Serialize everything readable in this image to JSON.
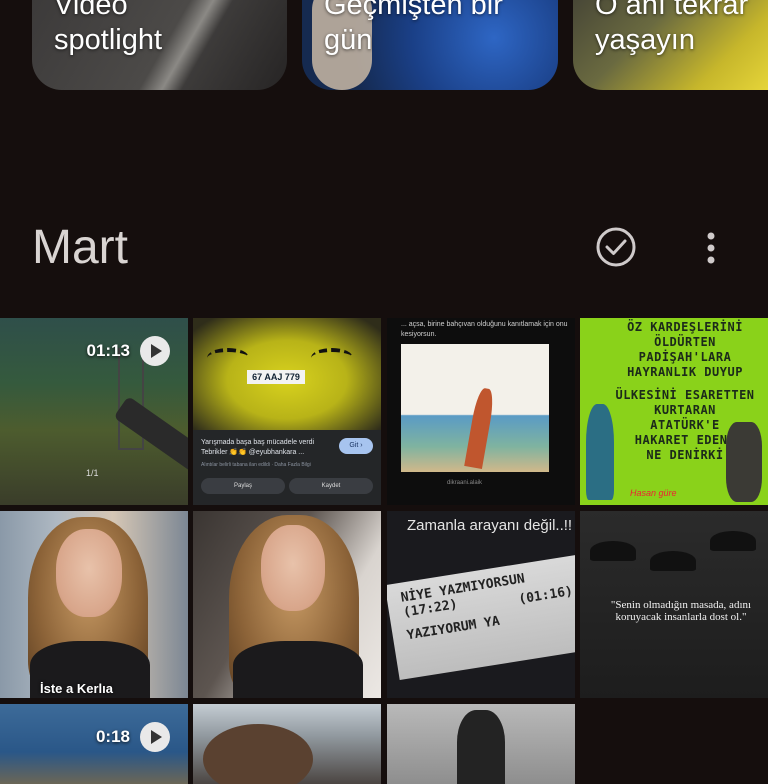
{
  "memories": [
    {
      "label": "Video\nspotlight"
    },
    {
      "label": "Geçmişten bir\ngün"
    },
    {
      "label": "O anı tekrar\nyaşayın"
    }
  ],
  "section": {
    "month": "Mart",
    "select_icon": "check-circle-icon",
    "more_icon": "more-vertical-icon"
  },
  "grid": {
    "video1_duration": "01:13",
    "video2_duration": "0:18",
    "tile1_counter": "1/1",
    "car_plate": "67 AAJ 779",
    "car_post_text": "Yarışmada başa baş mücadele verdi Tebrikler 👏👏 @eyubhankara ...",
    "car_post_sub": "Alıntılar belirli tabana ilan edildi · Daha Fazla Bilgi",
    "car_goto_button": "Git ›",
    "car_share_button": "Paylaş",
    "car_save_button": "Kaydet",
    "painting_text": "... açsa, birine bahçıvan olduğunu kanıtlamak için onu kesiyorsun.",
    "painting_caption": "dikraani.alaik",
    "poster_lines": [
      "ÖZ KARDEŞLERİNİ",
      "ÖLDÜRTEN",
      "PADİŞAH'LARA",
      "HAYRANLIK DUYUP",
      "ÜLKESİNİ ESARETTEN",
      "KURTARAN",
      "ATATÜRK'E",
      "HAKARET EDENE",
      "NE DENİRKİ"
    ],
    "poster_signature": "Hasan güre",
    "girl_tag": "İste a Kerlıa",
    "text_tile_title": "Zamanla arayanı değil..!!",
    "sign_line1": "NİYE YAZMIYORSUN (17:22)",
    "sign_line2": "YAZIYORUM YA",
    "sign_time2": "(01:16)",
    "quote": "\"Senin olmadığın masada, adını koruyacak insanlarla dost ol.\""
  }
}
